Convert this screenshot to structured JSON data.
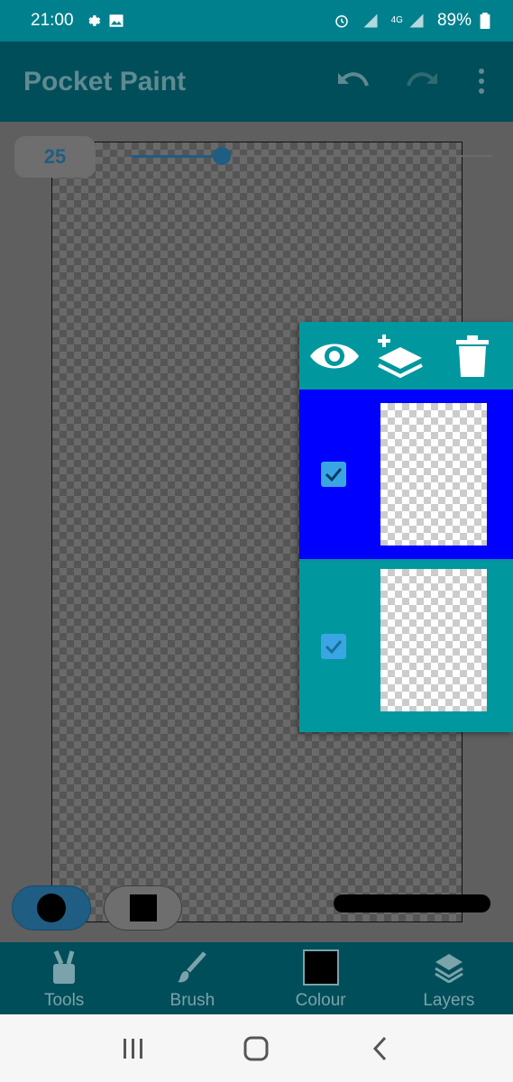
{
  "status_bar": {
    "time": "21:00",
    "battery": "89%",
    "network": "4G",
    "icons": [
      "settings-icon",
      "gallery-icon",
      "alarm-icon",
      "signal-icon",
      "battery-icon"
    ]
  },
  "app_bar": {
    "title": "Pocket Paint",
    "actions": [
      "undo-icon",
      "redo-icon",
      "more-vert-icon"
    ]
  },
  "brush_size": {
    "value": "25",
    "slider_fraction": 0.25
  },
  "layers_panel": {
    "toolbar": [
      "visibility-icon",
      "add-layer-icon",
      "delete-icon"
    ],
    "layers": [
      {
        "checked": true,
        "selected": true,
        "color": "#0000ff"
      },
      {
        "checked": true,
        "selected": false,
        "color": "#00979f"
      }
    ]
  },
  "bottom_nav": {
    "items": [
      {
        "label": "Tools",
        "icon": "tools-icon"
      },
      {
        "label": "Brush",
        "icon": "brush-icon"
      },
      {
        "label": "Colour",
        "icon": "colour-swatch-icon"
      },
      {
        "label": "Layers",
        "icon": "layers-icon"
      }
    ]
  },
  "system_nav": [
    "recent-apps-icon",
    "home-icon",
    "back-icon"
  ],
  "colors": {
    "primary": "#00808d",
    "primary_dark": "#004e59",
    "accent": "#1f5d83",
    "selected_layer": "#0000ff"
  }
}
